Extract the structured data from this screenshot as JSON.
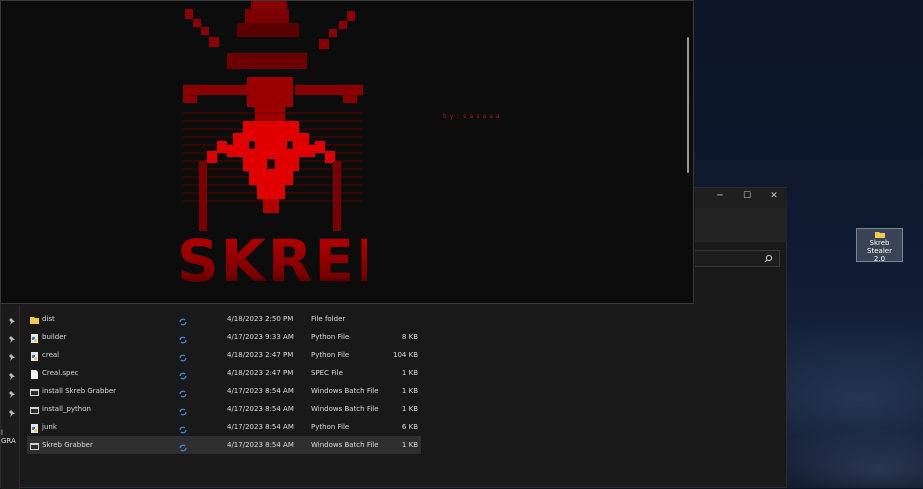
{
  "desktop": {
    "icon_label_line1": "Skreb Stealer",
    "icon_label_line2": "2.0"
  },
  "console": {
    "author_text": "by:sasaaa",
    "logo_text": "SKREB",
    "logo_color": "#d00000"
  },
  "explorer": {
    "nav_label": "l GRA",
    "files": [
      {
        "name": "dist",
        "date": "4/18/2023 2:50 PM",
        "type": "File folder",
        "size": "",
        "icon": "folder-icon"
      },
      {
        "name": "builder",
        "date": "4/17/2023 9:33 AM",
        "type": "Python File",
        "size": "8 KB",
        "icon": "python-file-icon"
      },
      {
        "name": "creal",
        "date": "4/18/2023 2:47 PM",
        "type": "Python File",
        "size": "104 KB",
        "icon": "python-file-icon"
      },
      {
        "name": "Creal.spec",
        "date": "4/18/2023 2:47 PM",
        "type": "SPEC File",
        "size": "1 KB",
        "icon": "file-icon"
      },
      {
        "name": "install Skreb Grabber",
        "date": "4/17/2023 8:54 AM",
        "type": "Windows Batch File",
        "size": "1 KB",
        "icon": "batch-file-icon"
      },
      {
        "name": "install_python",
        "date": "4/17/2023 8:54 AM",
        "type": "Windows Batch File",
        "size": "1 KB",
        "icon": "batch-file-icon"
      },
      {
        "name": "junk",
        "date": "4/17/2023 8:54 AM",
        "type": "Python File",
        "size": "6 KB",
        "icon": "python-file-icon"
      },
      {
        "name": "Skreb Grabber",
        "date": "4/17/2023 8:54 AM",
        "type": "Windows Batch File",
        "size": "1 KB",
        "icon": "batch-file-icon"
      }
    ]
  }
}
